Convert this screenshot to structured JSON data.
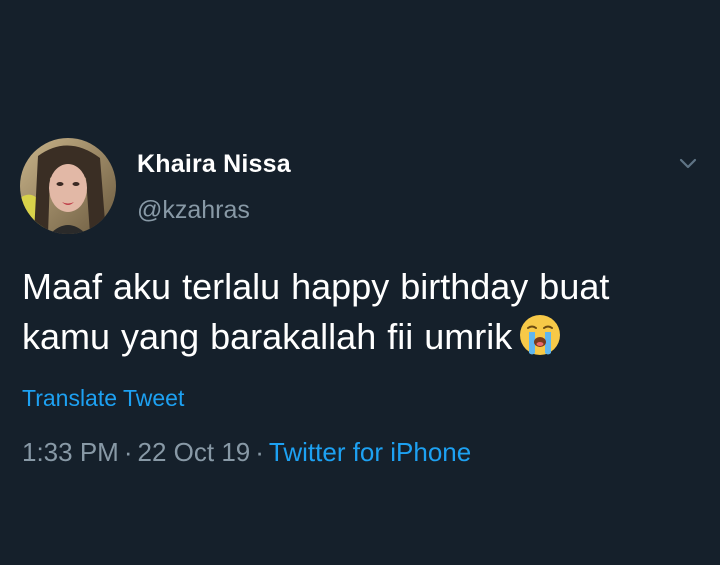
{
  "tweet": {
    "author": {
      "display_name": "Khaira Nissa",
      "handle": "@kzahras"
    },
    "text_line1": "Maaf aku terlalu happy birthday buat",
    "text_line2": "kamu yang barakallah fii umrik",
    "emoji": "loudly-crying-face",
    "translate_label": "Translate Tweet",
    "time": "1:33 PM",
    "separator": "·",
    "date": "22 Oct 19",
    "source": "Twitter for iPhone"
  },
  "colors": {
    "background": "#15202b",
    "primary_text": "#ffffff",
    "secondary_text": "#8899a6",
    "accent": "#1da1f2"
  },
  "icons": {
    "menu": "chevron-down-icon"
  }
}
